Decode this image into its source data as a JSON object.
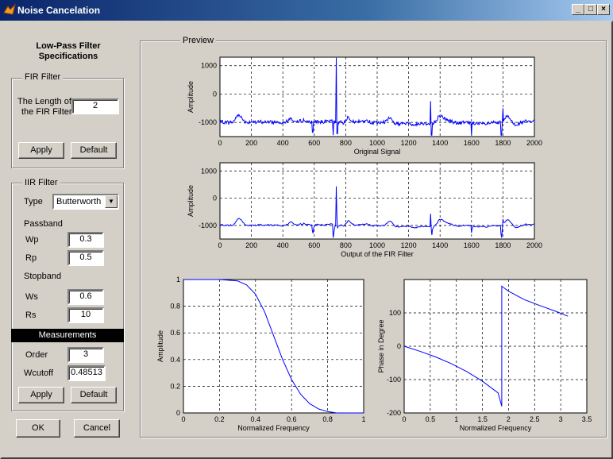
{
  "window": {
    "title": "Noise Cancelation",
    "buttons": {
      "minimize": "_",
      "maximize": "□",
      "close": "×"
    }
  },
  "left_panel": {
    "heading_line1": "Low-Pass Filter",
    "heading_line2": "Specifications",
    "fir": {
      "group_label": "FIR Filter",
      "length_label_line1": "The Length of",
      "length_label_line2": "the FIR Filter",
      "length_value": "2",
      "apply_label": "Apply",
      "default_label": "Default"
    },
    "iir": {
      "group_label": "IIR Filter",
      "type_label": "Type",
      "type_value": "Butterworth",
      "passband_label": "Passband",
      "wp_label": "Wp",
      "wp_value": "0.3",
      "rp_label": "Rp",
      "rp_value": "0.5",
      "stopband_label": "Stopband",
      "ws_label": "Ws",
      "ws_value": "0.6",
      "rs_label": "Rs",
      "rs_value": "10",
      "measurements_label": "Measurements",
      "order_label": "Order",
      "order_value": "3",
      "wcutoff_label": "Wcutoff",
      "wcutoff_value": "0.48513",
      "apply_label": "Apply",
      "default_label": "Default"
    },
    "ok_label": "OK",
    "cancel_label": "Cancel"
  },
  "preview": {
    "group_label": "Preview"
  },
  "chart_data": [
    {
      "type": "line",
      "xlabel": "Original Signal",
      "ylabel": "Amplitude",
      "xlim": [
        0,
        2000
      ],
      "ylim": [
        -1500,
        1300
      ],
      "xticks": [
        "0",
        "200",
        "400",
        "600",
        "800",
        "1000",
        "1200",
        "1400",
        "1600",
        "1800",
        "2000"
      ],
      "yticks": [
        "1000",
        "0",
        "-1000"
      ],
      "grid": true,
      "color": "#0000ff",
      "approx_shape": "noisy baseline near -1000, spikes at x≈590, 720, 740, 1340, 1600, 1790; peak ≈1300 at x≈740"
    },
    {
      "type": "line",
      "xlabel": "Output of the FIR Filter",
      "ylabel": "Amplitude",
      "xlim": [
        0,
        2000
      ],
      "ylim": [
        -1500,
        1300
      ],
      "xticks": [
        "0",
        "200",
        "400",
        "600",
        "800",
        "1000",
        "1200",
        "1400",
        "1600",
        "1800",
        "2000"
      ],
      "yticks": [
        "1000",
        "0",
        "-1000"
      ],
      "grid": true,
      "color": "#0000ff",
      "approx_shape": "filtered version of original signal, same spikes"
    },
    {
      "type": "line",
      "xlabel": "Normalized Frequency",
      "ylabel": "Amplitude",
      "xlim": [
        0,
        1
      ],
      "ylim": [
        0,
        1
      ],
      "xticks": [
        "0",
        "0.2",
        "0.4",
        "0.6",
        "0.8",
        "1"
      ],
      "yticks": [
        "0",
        "0.2",
        "0.4",
        "0.6",
        "0.8",
        "1"
      ],
      "grid": true,
      "color": "#0000ff",
      "x": [
        0,
        0.2,
        0.3,
        0.35,
        0.4,
        0.45,
        0.5,
        0.55,
        0.6,
        0.65,
        0.7,
        0.75,
        0.8,
        0.85,
        0.9,
        1.0
      ],
      "y": [
        1,
        1,
        0.99,
        0.96,
        0.89,
        0.76,
        0.58,
        0.4,
        0.25,
        0.14,
        0.07,
        0.03,
        0.01,
        0.0,
        0.0,
        0.0
      ]
    },
    {
      "type": "line",
      "xlabel": "Normalized Frequency",
      "ylabel": "Phase in Degree",
      "xlim": [
        0,
        3.5
      ],
      "ylim": [
        -200,
        200
      ],
      "xticks": [
        "0",
        "0.5",
        "1",
        "1.5",
        "2",
        "2.5",
        "3",
        "3.5"
      ],
      "yticks": [
        "-200",
        "-100",
        "0",
        "100"
      ],
      "grid": true,
      "color": "#0000ff",
      "x": [
        0,
        0.3,
        0.6,
        0.9,
        1.2,
        1.5,
        1.8,
        1.87,
        1.87,
        2.0,
        2.3,
        2.6,
        2.9,
        3.14
      ],
      "y": [
        0,
        -15,
        -32,
        -52,
        -76,
        -105,
        -140,
        -180,
        180,
        165,
        140,
        122,
        105,
        90
      ]
    }
  ]
}
